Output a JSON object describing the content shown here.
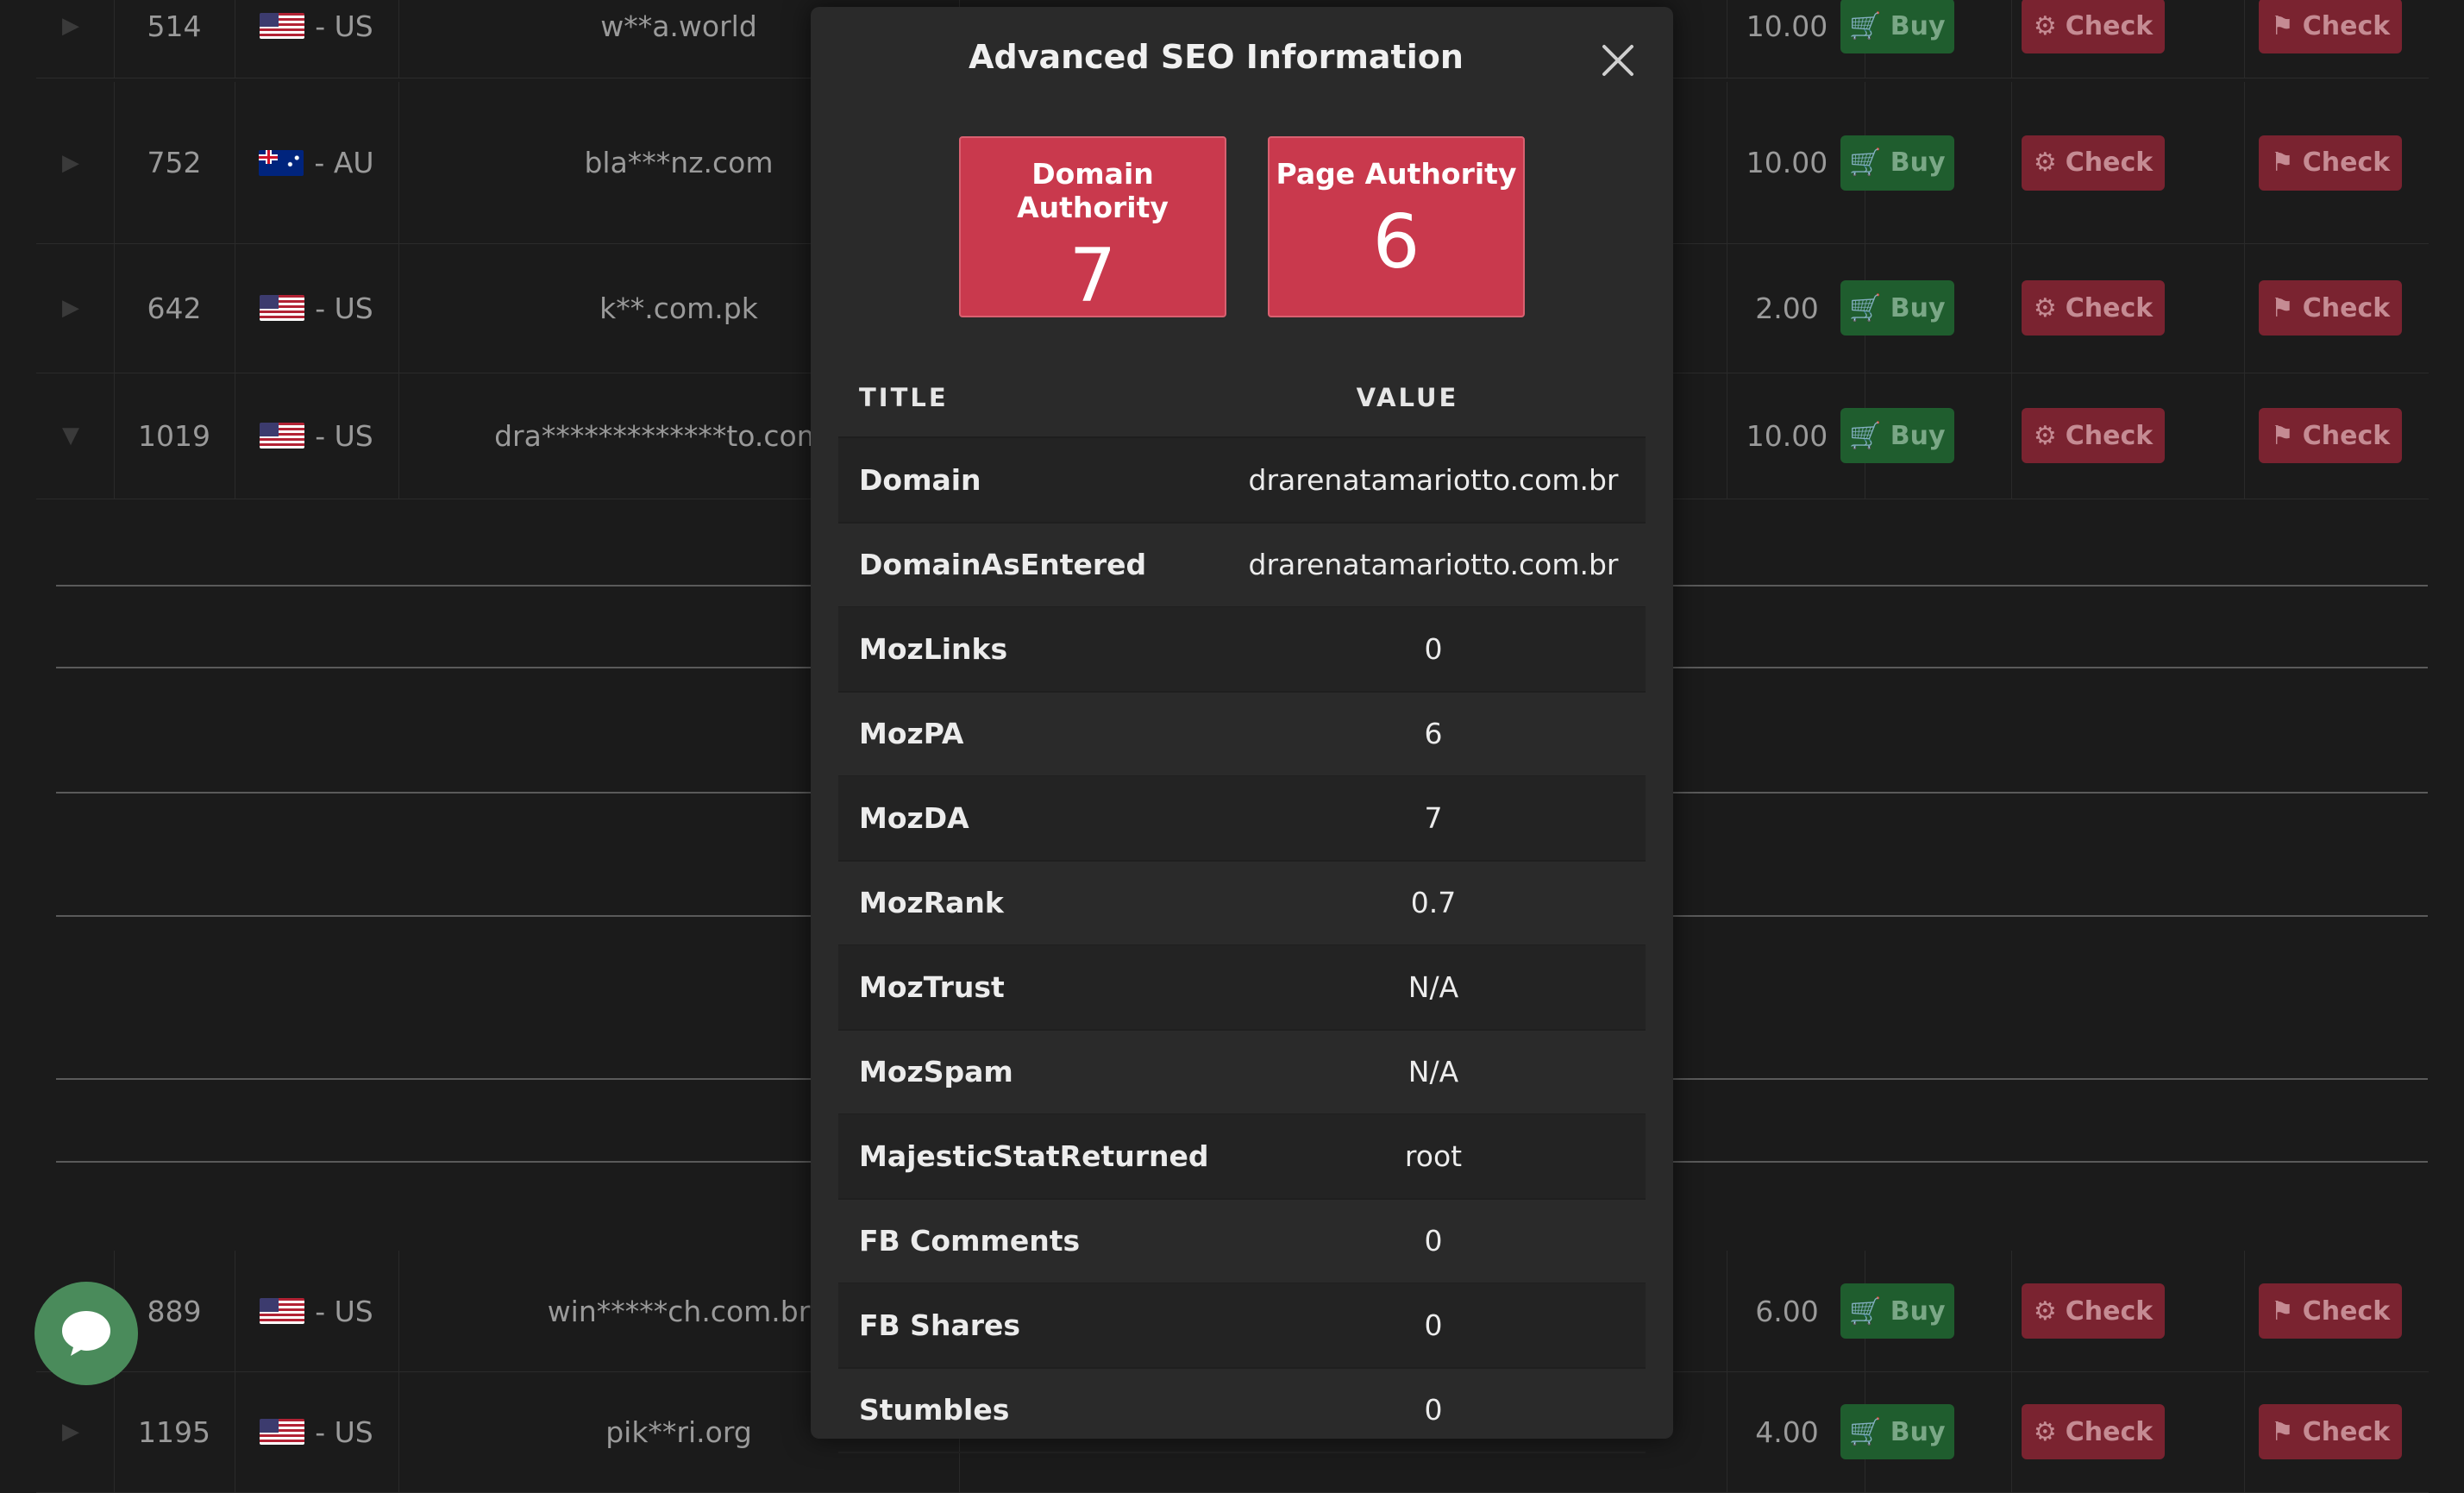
{
  "background_rows": [
    {
      "id": "514",
      "flag": "us",
      "country": "- US",
      "domain": "w**a.world",
      "price": "10.00",
      "expanded": false
    },
    {
      "id": "752",
      "flag": "au",
      "country": "- AU",
      "domain": "bla***nz.com",
      "price": "10.00",
      "expanded": false
    },
    {
      "id": "642",
      "flag": "us",
      "country": "- US",
      "domain": "k**.com.pk",
      "price": "2.00",
      "expanded": false
    },
    {
      "id": "1019",
      "flag": "us",
      "country": "- US",
      "domain": "dra*************to.com.br",
      "price": "10.00",
      "expanded": true
    },
    {
      "id": "889",
      "flag": "us",
      "country": "- US",
      "domain": "win*****ch.com.br",
      "price": "6.00",
      "expanded": false
    },
    {
      "id": "1195",
      "flag": "us",
      "country": "- US",
      "domain": "pik**ri.org",
      "price": "4.00",
      "expanded": false
    }
  ],
  "row_buttons": {
    "buy": "Buy",
    "check_seo": "Check",
    "check_report": "Check"
  },
  "modal": {
    "title": "Advanced SEO Information",
    "metrics": [
      {
        "label": "Domain Authority",
        "value": "7"
      },
      {
        "label": "Page Authority",
        "value": "6"
      }
    ],
    "table_headers": {
      "title": "TITLE",
      "value": "VALUE"
    },
    "rows": [
      {
        "title": "Domain",
        "value": "drarenatamariotto.com.br"
      },
      {
        "title": "DomainAsEntered",
        "value": "drarenatamariotto.com.br"
      },
      {
        "title": "MozLinks",
        "value": "0"
      },
      {
        "title": "MozPA",
        "value": "6"
      },
      {
        "title": "MozDA",
        "value": "7"
      },
      {
        "title": "MozRank",
        "value": "0.7"
      },
      {
        "title": "MozTrust",
        "value": "N/A"
      },
      {
        "title": "MozSpam",
        "value": "N/A"
      },
      {
        "title": "MajesticStatReturned",
        "value": "root"
      },
      {
        "title": "FB Comments",
        "value": "0"
      },
      {
        "title": "FB Shares",
        "value": "0"
      },
      {
        "title": "Stumbles",
        "value": "0"
      }
    ]
  },
  "colors": {
    "buy": "#1f5d2e",
    "check": "#7a2330",
    "metric": "#c9394d",
    "chat": "#4a8b5b"
  }
}
